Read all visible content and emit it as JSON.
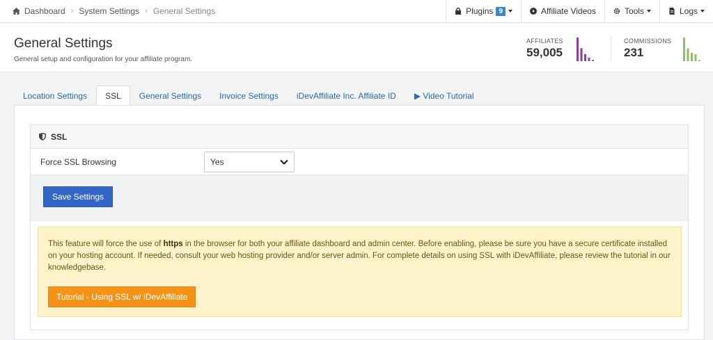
{
  "breadcrumb": {
    "items": [
      "Dashboard",
      "System Settings",
      "General Settings"
    ]
  },
  "topnav": {
    "plugins_label": "Plugins",
    "plugins_count": "9",
    "videos_label": "Affiliate Videos",
    "tools_label": "Tools",
    "logs_label": "Logs"
  },
  "header": {
    "title": "General Settings",
    "subtitle": "General setup and configuration for your affiliate program.",
    "stats": [
      {
        "label": "AFFILIATES",
        "value": "59,005",
        "color": "#8b3fa3",
        "bars": [
          1.0,
          0.55,
          0.3,
          0.15,
          0.05
        ]
      },
      {
        "label": "COMMISSIONS",
        "value": "231",
        "color": "#8fbf6a",
        "bars": [
          1.0,
          0.55,
          0.35,
          0.3,
          0.05
        ]
      }
    ]
  },
  "tabs": [
    {
      "label": "Location Settings",
      "active": false
    },
    {
      "label": "SSL",
      "active": true
    },
    {
      "label": "General Settings",
      "active": false
    },
    {
      "label": "Invoice Settings",
      "active": false
    },
    {
      "label": "iDevAffiliate Inc. Affiliate ID",
      "active": false
    },
    {
      "label": "▶ Video Tutorial",
      "active": false
    }
  ],
  "ssl": {
    "section_title": "SSL",
    "field_label": "Force SSL Browsing",
    "field_value": "Yes",
    "save_label": "Save Settings",
    "alert_pre": "This feature will force the use of ",
    "alert_bold": "https",
    "alert_post": " in the browser for both your affiliate dashboard and admin center. Before enabling, please be sure you have a secure certificate installed on your hosting account. If needed, consult your web hosting provider and/or server admin. For complete details on using SSL with iDevAffiliate, please review the tutorial in our knowledgebase.",
    "tutorial_label": "Tutorial - Using SSL w/ iDevAffiliate"
  },
  "colors": {
    "primary": "#3366c7",
    "warning_button": "#f39419",
    "alert_bg": "#fdf2c9",
    "link": "#2a6aa8"
  }
}
